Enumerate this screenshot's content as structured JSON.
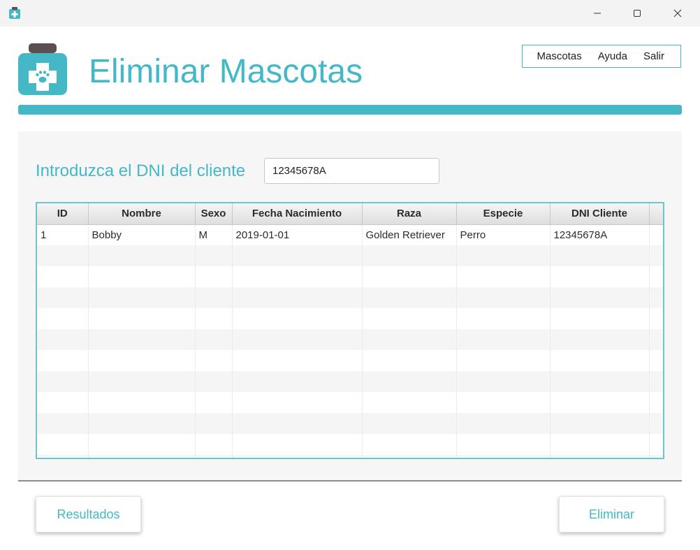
{
  "window": {
    "icons": {
      "app": "clinic-logo-icon",
      "minimize": "minimize-icon",
      "maximize": "maximize-icon",
      "close": "close-icon"
    }
  },
  "header": {
    "title": "Eliminar Mascotas",
    "logo_icon": "pet-clinic-logo-icon",
    "accent_color": "#45b8c8"
  },
  "menu": {
    "items": [
      {
        "label": "Mascotas"
      },
      {
        "label": "Ayuda"
      },
      {
        "label": "Salir"
      }
    ]
  },
  "search": {
    "label": "Introduzca el DNI del cliente",
    "value": "12345678A",
    "placeholder": ""
  },
  "table": {
    "columns": [
      "ID",
      "Nombre",
      "Sexo",
      "Fecha Nacimiento",
      "Raza",
      "Especie",
      "DNI Cliente"
    ],
    "rows": [
      [
        "1",
        "Bobby",
        "M",
        "2019-01-01",
        "Golden Retriever",
        "Perro",
        "12345678A"
      ]
    ]
  },
  "actions": {
    "results_label": "Resultados",
    "delete_label": "Eliminar"
  }
}
